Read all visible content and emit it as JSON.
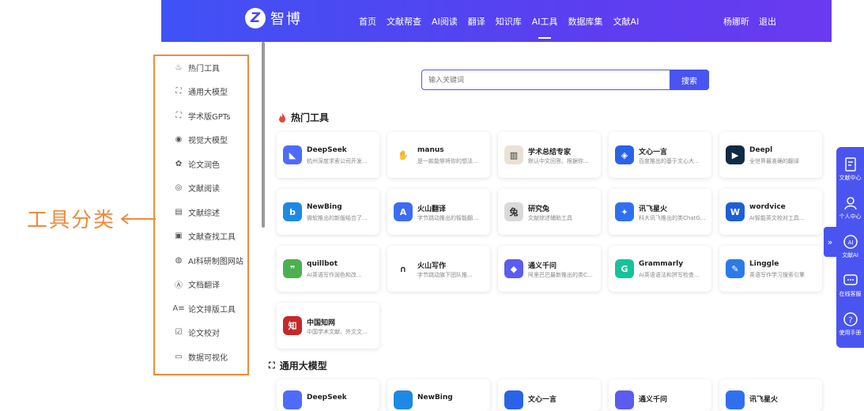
{
  "header": {
    "logo_mark": "Z",
    "logo_text": "智博",
    "nav": [
      "首页",
      "文献帮查",
      "AI阅读",
      "翻译",
      "知识库",
      "AI工具",
      "数据库集",
      "文献AI"
    ],
    "active_nav": 5,
    "user_name": "杨娜昕",
    "logout": "退出"
  },
  "sidebar": {
    "items": [
      {
        "label": "热门工具",
        "icon": "fire-icon"
      },
      {
        "label": "通用大模型",
        "icon": "model-icon"
      },
      {
        "label": "学术版GPTs",
        "icon": "gpt-icon"
      },
      {
        "label": "视觉大模型",
        "icon": "eye-icon"
      },
      {
        "label": "论文润色",
        "icon": "palette-icon"
      },
      {
        "label": "文献阅读",
        "icon": "signal-icon"
      },
      {
        "label": "文献综述",
        "icon": "book-icon"
      },
      {
        "label": "文献查找工具",
        "icon": "search-doc-icon"
      },
      {
        "label": "AI科研制图网站",
        "icon": "chart-icon"
      },
      {
        "label": "文档翻译",
        "icon": "translate-icon"
      },
      {
        "label": "论文排版工具",
        "icon": "layout-icon"
      },
      {
        "label": "论文校对",
        "icon": "check-doc-icon"
      },
      {
        "label": "数据可视化",
        "icon": "screen-icon"
      }
    ]
  },
  "annotation": {
    "text": "工具分类"
  },
  "search": {
    "placeholder": "输入关键词",
    "button": "搜索"
  },
  "sections": {
    "hot": "热门工具",
    "general": "通用大模型"
  },
  "cards": [
    {
      "name": "DeepSeek",
      "desc": "杭州深度求索公司开发...",
      "icon": "deepseek-icon",
      "color": "#4d6bfe",
      "glyph": "◣"
    },
    {
      "name": "manus",
      "desc": "是一款能够将你的想法...",
      "icon": "manus-icon",
      "color": "#ffffff",
      "glyph": "✋"
    },
    {
      "name": "学术总结专家",
      "desc": "默认中文回答。根据你...",
      "icon": "scholar-icon",
      "color": "#e9e2d4",
      "glyph": "▥"
    },
    {
      "name": "文心一言",
      "desc": "百度推出的基于文心大...",
      "icon": "wenxin-icon",
      "color": "#2b63e8",
      "glyph": "◈"
    },
    {
      "name": "Deepl",
      "desc": "全世界最准确的翻译",
      "icon": "deepl-icon",
      "color": "#0f2b46",
      "glyph": "▶"
    },
    {
      "name": "NewBing",
      "desc": "微软推出的新版结合了...",
      "icon": "newbing-icon",
      "color": "#1e88e5",
      "glyph": "b"
    },
    {
      "name": "火山翻译",
      "desc": "字节跳动推出的智能翻...",
      "icon": "volc-icon",
      "color": "#3c6cf5",
      "glyph": "A"
    },
    {
      "name": "研究兔",
      "desc": "文献综述辅助工具",
      "icon": "rabbit-icon",
      "color": "#d9d9d9",
      "glyph": "兔"
    },
    {
      "name": "讯飞星火",
      "desc": "科大讯飞推出的类ChatG...",
      "icon": "spark-icon",
      "color": "#3070f0",
      "glyph": "✦"
    },
    {
      "name": "wordvice",
      "desc": "AI智能英文校对工具...",
      "icon": "wordvice-icon",
      "color": "#1f5fd6",
      "glyph": "W"
    },
    {
      "name": "quillbot",
      "desc": "AI英语写作润色和改...",
      "icon": "quillbot-icon",
      "color": "#4caf50",
      "glyph": "❞"
    },
    {
      "name": "火山写作",
      "desc": "字节跳动旗下团队推...",
      "icon": "volc-write-icon",
      "color": "#ffffff",
      "glyph": "∩"
    },
    {
      "name": "通义千问",
      "desc": "阿里巴巴最新推出的类C...",
      "icon": "tongyi-icon",
      "color": "#5b5cf0",
      "glyph": "◆"
    },
    {
      "name": "Grammarly",
      "desc": "AI英语语法和拼写检查...",
      "icon": "grammarly-icon",
      "color": "#15c39a",
      "glyph": "G"
    },
    {
      "name": "Linggle",
      "desc": "英语写作学习搜索引擎",
      "icon": "linggle-icon",
      "color": "#2c7be5",
      "glyph": "✎"
    },
    {
      "name": "中国知网",
      "desc": "中国学术文献、外文文...",
      "icon": "cnki-icon",
      "color": "#c62828",
      "glyph": "知"
    }
  ],
  "bottom_cards": [
    {
      "name": "DeepSeek",
      "icon": "deepseek-icon",
      "color": "#4d6bfe"
    },
    {
      "name": "NewBing",
      "icon": "newbing-icon",
      "color": "#1e88e5"
    },
    {
      "name": "文心一言",
      "icon": "wenxin-icon",
      "color": "#2b63e8"
    },
    {
      "name": "通义千问",
      "icon": "tongyi-icon",
      "color": "#5b5cf0"
    },
    {
      "name": "讯飞星火",
      "icon": "spark-icon",
      "color": "#3070f0"
    }
  ],
  "right_panel": {
    "toggle": "»",
    "items": [
      {
        "label": "文献中心",
        "icon": "doc-center-icon"
      },
      {
        "label": "个人中心",
        "icon": "user-icon"
      },
      {
        "label": "文献AI",
        "icon": "ai-icon"
      },
      {
        "label": "在线客服",
        "icon": "chat-icon"
      },
      {
        "label": "使用手册",
        "icon": "help-icon"
      }
    ]
  },
  "colors": {
    "brand": "#4a54f1",
    "annotation": "#f08a3c"
  }
}
